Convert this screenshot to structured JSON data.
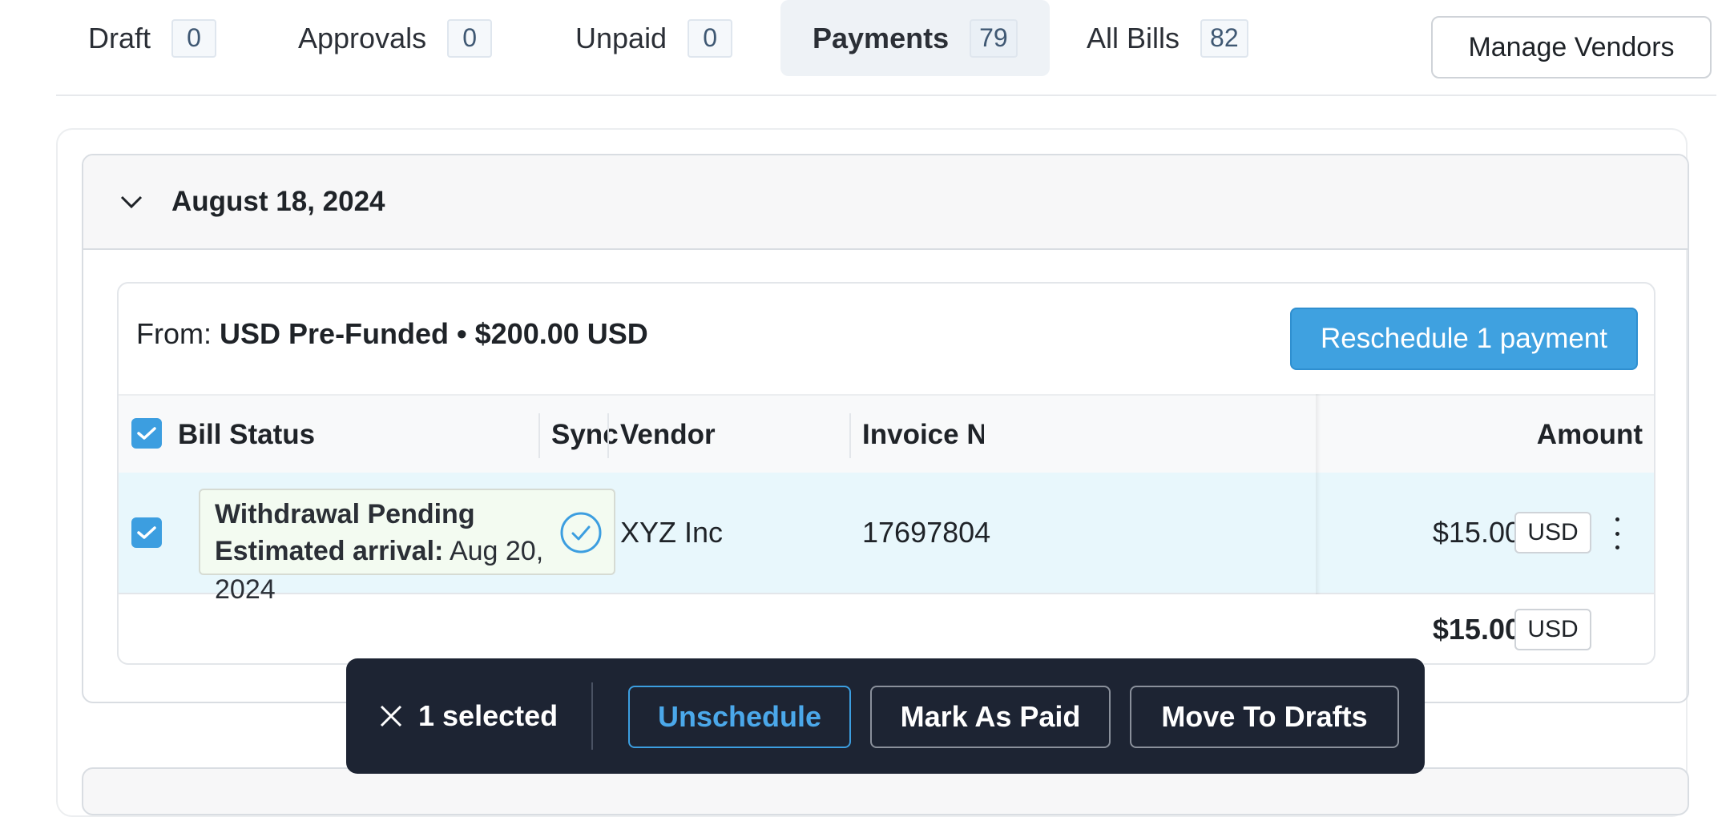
{
  "tabs": [
    {
      "label": "Draft",
      "count": "0"
    },
    {
      "label": "Approvals",
      "count": "0"
    },
    {
      "label": "Unpaid",
      "count": "0"
    },
    {
      "label": "Payments",
      "count": "79"
    },
    {
      "label": "All Bills",
      "count": "82"
    }
  ],
  "active_tab": "Payments",
  "manage_vendors_label": "Manage Vendors",
  "group": {
    "date": "August 18, 2024",
    "expanded": true
  },
  "payment": {
    "from_prefix": "From:",
    "from_value": "USD Pre-Funded • $200.00 USD",
    "reschedule_label": "Reschedule 1 payment"
  },
  "table": {
    "columns": {
      "bill_status": "Bill Status",
      "sync": "Sync",
      "vendor": "Vendor",
      "invoice": "Invoice Num",
      "amount": "Amount"
    },
    "header_checked": true,
    "rows": [
      {
        "checked": true,
        "status_title": "Withdrawal Pending",
        "status_label": "Estimated arrival:",
        "status_date": "Aug 20, 2024",
        "sync": "synced",
        "vendor": "XYZ Inc",
        "invoice": "17697804",
        "amount": "$15.00",
        "currency": "USD"
      }
    ],
    "total": {
      "amount": "$15.00",
      "currency": "USD"
    }
  },
  "action_bar": {
    "selected_text": "1 selected",
    "unschedule_label": "Unschedule",
    "mark_paid_label": "Mark As Paid",
    "move_drafts_label": "Move To Drafts"
  },
  "colors": {
    "accent": "#3c9ee0",
    "row_highlight": "#e8f7fc",
    "action_bar_bg": "#1d2433",
    "status_bg": "#f3fbf1"
  }
}
